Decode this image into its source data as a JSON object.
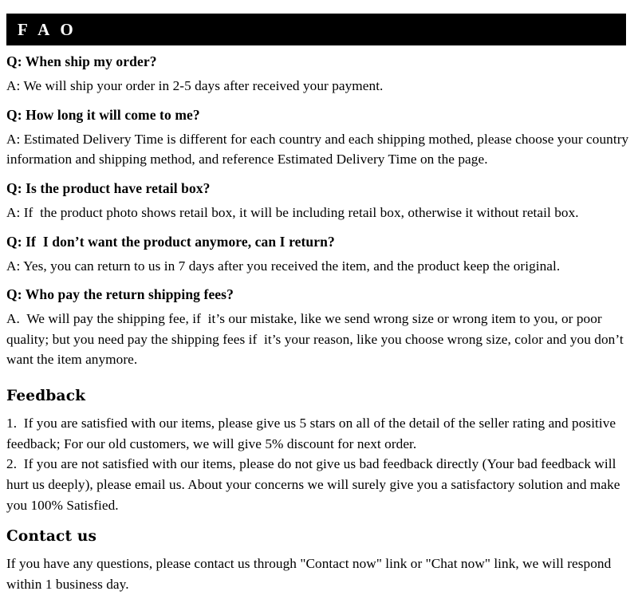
{
  "header": {
    "title": "F A O",
    "background_color": "#000000",
    "text_color": "#ffffff"
  },
  "faq": {
    "items": [
      {
        "question": "Q: When ship my order?",
        "answer": "A: We will ship your order in 2-5 days after received your payment."
      },
      {
        "question": "Q: How long it will come to me?",
        "answer": "A: Estimated Delivery Time is different for each country and each shipping mothed, please choose your country information and shipping method, and reference Estimated Delivery Time on the page."
      },
      {
        "question": "Q: Is the product have retail box?",
        "answer": "A: If  the product photo shows retail box, it will be including retail box, otherwise it without retail box."
      },
      {
        "question": "Q: If  I don’t want the product anymore, can I return?",
        "answer": "A: Yes, you can return to us in 7 days after you received the item, and the product keep the original."
      },
      {
        "question": "Q: Who pay the return shipping fees?",
        "answer": "A.  We will pay the shipping fee, if  it’s our mistake, like we send wrong size or wrong item to you, or poor quality; but you need pay the shipping fees if  it’s your reason, like you choose wrong size, color and you don’t want the item anymore."
      }
    ]
  },
  "feedback": {
    "heading": "Feedback",
    "paragraphs": [
      "1.  If you are satisfied with our items, please give us 5 stars on all of the detail of the seller rating and positive feedback; For our old customers, we will give 5% discount for next order.",
      "2.  If you are not satisfied with our items, please do not give us bad feedback directly (Your bad feedback will hurt us deeply), please email us. About your concerns we will surely give you a satisfactory solution and make you 100% Satisfied."
    ]
  },
  "contact": {
    "heading": "Contact us",
    "paragraphs": [
      "If you have any questions, please contact us through \"Contact now\" link or \"Chat now\" link, we will respond within 1 business day."
    ]
  }
}
